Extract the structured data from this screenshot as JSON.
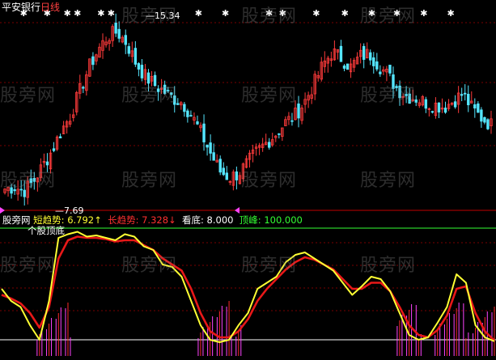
{
  "title": {
    "stock_name": "平安银行",
    "period": "日线"
  },
  "watermark_text": "股旁网",
  "price_panel": {
    "high_label": "15.34",
    "low_label": "7.69"
  },
  "indicator_panel": {
    "site_label": "股旁网",
    "indicator_name": "个股顶底",
    "readouts": [
      {
        "label": "短趋势",
        "value": "6.792",
        "arrow": "↑",
        "color": "#ffff33"
      },
      {
        "label": "长趋势",
        "value": "7.328",
        "arrow": "↓",
        "color": "#ff3030"
      },
      {
        "label": "看底",
        "value": "8.000",
        "arrow": "",
        "color": "#ffffff"
      },
      {
        "label": "顶峰",
        "value": "100.000",
        "arrow": "",
        "color": "#33ff33"
      }
    ]
  },
  "colors": {
    "up_candle": "#ff3b3b",
    "down_candle": "#55e6ff",
    "short_trend": "#ffff33",
    "long_trend": "#e81818",
    "bottom_line": "#ffffff",
    "peak_line": "#33ff33",
    "signal_bars": "#ff44ff",
    "grid": "#7a0000"
  },
  "chart_data": [
    {
      "type": "candlestick",
      "name_ref": "title.stock_name",
      "price_range": [
        7.0,
        16.0
      ],
      "labeled_extremes": {
        "high": 15.34,
        "low": 7.69
      },
      "close_path": [
        7.9,
        8.0,
        7.8,
        8.2,
        8.9,
        9.6,
        10.5,
        11.2,
        12.3,
        13.4,
        14.2,
        14.8,
        15.0,
        14.5,
        13.6,
        13.0,
        12.6,
        12.3,
        12.0,
        11.8,
        11.2,
        10.4,
        9.5,
        8.7,
        8.4,
        8.6,
        9.1,
        9.6,
        10.0,
        10.4,
        10.9,
        11.2,
        11.8,
        12.6,
        13.5,
        14.1,
        13.8,
        13.4,
        13.9,
        14.0,
        13.5,
        13.0,
        12.4,
        12.1,
        12.0,
        11.8,
        11.7,
        11.6,
        11.9,
        12.2,
        11.5,
        11.1,
        10.8
      ],
      "grid": true
    },
    {
      "type": "line",
      "name_ref": "indicator_panel.indicator_name",
      "y_range": [
        0,
        100
      ],
      "series": [
        {
          "name": "短趋势",
          "values": [
            50,
            40,
            35,
            20,
            8,
            40,
            92,
            95,
            97,
            93,
            94,
            92,
            90,
            95,
            93,
            85,
            82,
            70,
            68,
            60,
            40,
            20,
            8,
            6,
            8,
            20,
            30,
            50,
            55,
            60,
            72,
            78,
            80,
            75,
            70,
            65,
            55,
            45,
            52,
            60,
            58,
            48,
            30,
            12,
            8,
            10,
            22,
            35,
            62,
            55,
            20,
            10,
            6.8
          ]
        },
        {
          "name": "长趋势",
          "values": [
            45,
            42,
            38,
            30,
            18,
            35,
            75,
            90,
            93,
            92,
            92,
            91,
            89,
            90,
            90,
            86,
            82,
            75,
            70,
            65,
            50,
            30,
            15,
            10,
            10,
            15,
            25,
            40,
            50,
            58,
            66,
            72,
            76,
            74,
            70,
            66,
            58,
            50,
            50,
            55,
            55,
            48,
            35,
            20,
            12,
            10,
            16,
            28,
            50,
            52,
            30,
            15,
            7.3
          ]
        }
      ],
      "reference_levels": [
        {
          "name": "看底",
          "value": 8
        },
        {
          "name": "顶峰",
          "value": 100
        }
      ],
      "grid": true
    }
  ]
}
